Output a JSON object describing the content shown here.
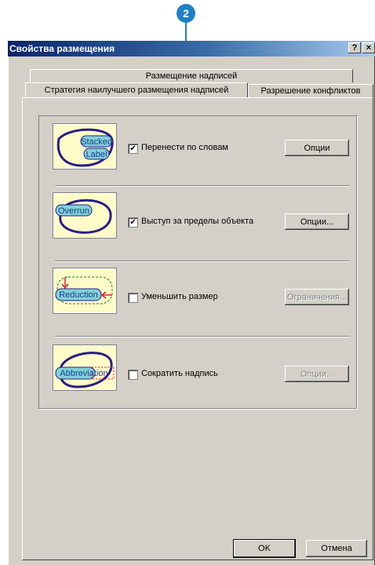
{
  "callout": {
    "number": "2"
  },
  "window": {
    "title": "Свойства размещения"
  },
  "title_buttons": {
    "help": "?",
    "close": "×"
  },
  "tabs": {
    "back": "Размещение надписей",
    "active": "Стратегия наилучшего размещения надписей",
    "conflicts": "Разрешение конфликтов"
  },
  "rows": [
    {
      "thumb_text": [
        "Stacked",
        "Label"
      ],
      "checked": true,
      "label": "Перенести по словам",
      "button": "Опции"
    },
    {
      "thumb_text": [
        "Overrun"
      ],
      "checked": true,
      "label": "Выступ за пределы объекта",
      "button": "Опции..."
    },
    {
      "thumb_text": [
        "Reduction"
      ],
      "checked": false,
      "label": "Уменьшить размер",
      "button": "Ограничения..."
    },
    {
      "thumb_text": [
        "Abbreviation"
      ],
      "checked": false,
      "label": "Сократить надпись",
      "button": "Опции..."
    }
  ],
  "footer": {
    "ok": "OK",
    "cancel": "Отмена"
  },
  "colors": {
    "accent": "#1f7fc6",
    "title_start": "#0a246a",
    "thumb_bg": "#fffbc8",
    "oval": "#2a1d8a",
    "label_fill": "#7fd1d6",
    "red": "#e0202a"
  }
}
